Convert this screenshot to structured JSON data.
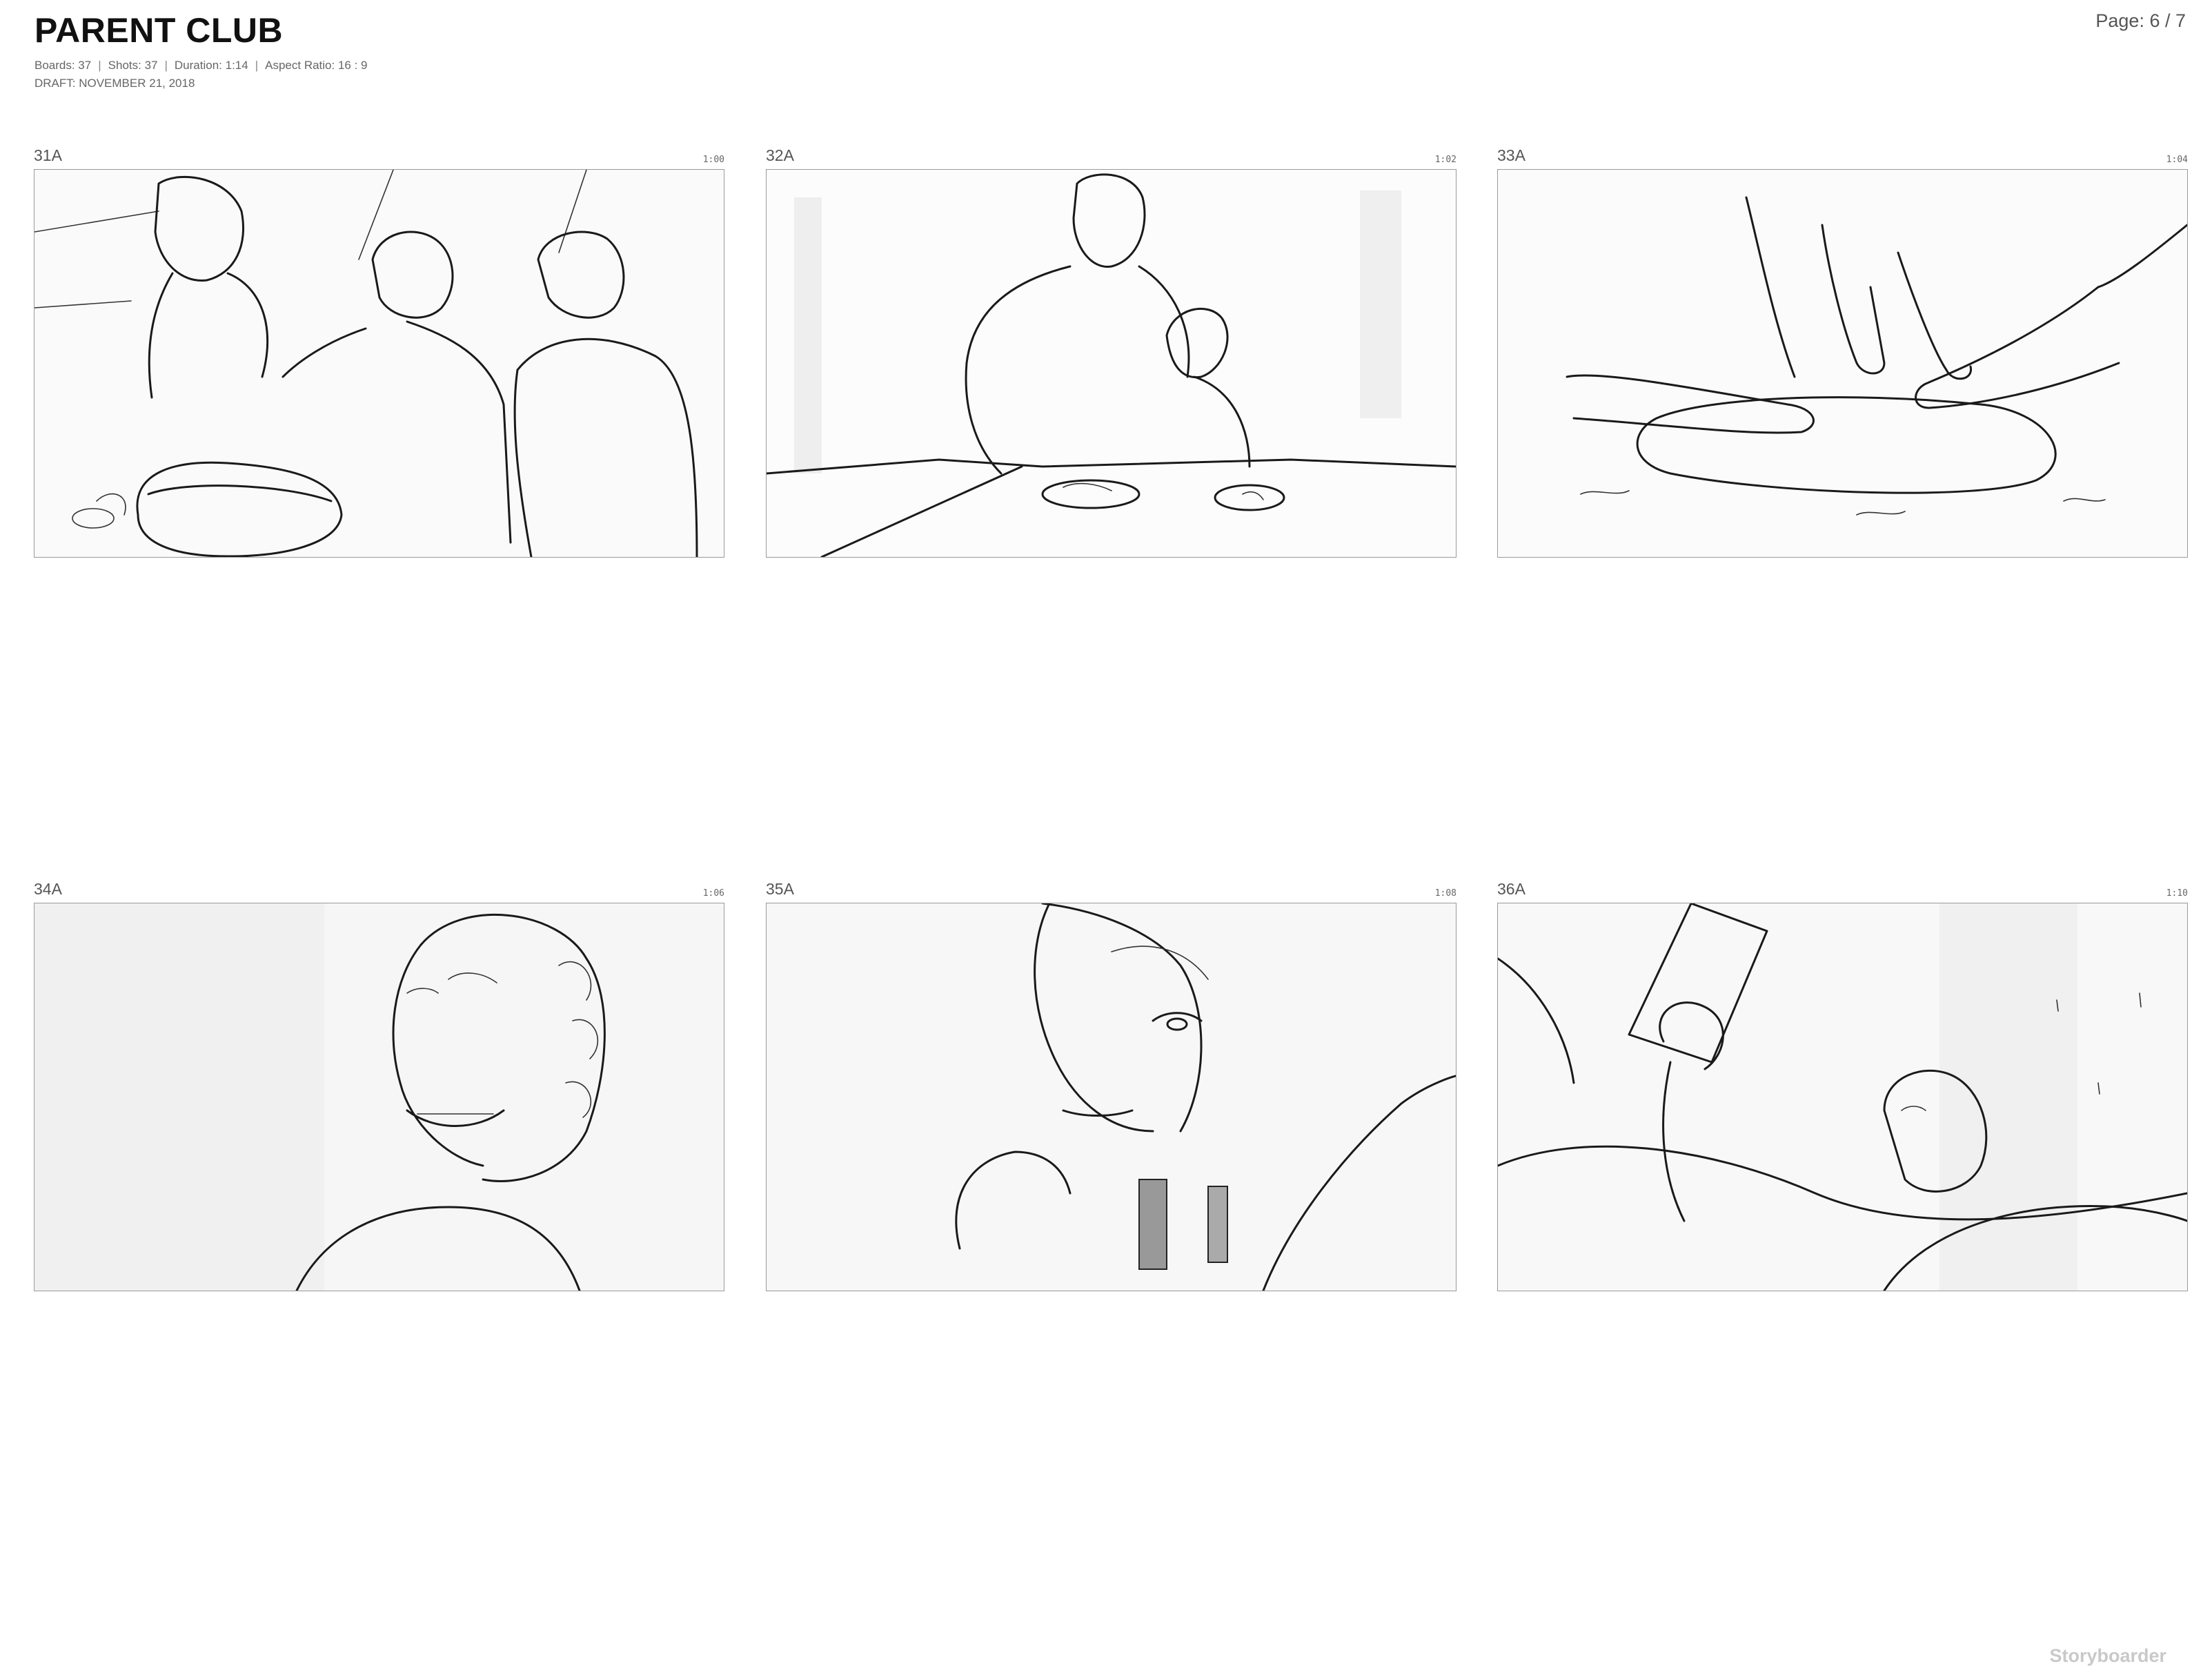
{
  "document": {
    "title": "PARENT CLUB",
    "meta": {
      "boards": "Boards: 37",
      "shots": "Shots: 37",
      "duration": "Duration: 1:14",
      "aspect_ratio": "Aspect Ratio: 16 : 9",
      "draft": "DRAFT: NOVEMBER 21, 2018"
    },
    "page": "Page: 6 / 7",
    "watermark": "Storyboarder"
  },
  "boards": [
    {
      "number": "31A",
      "time": "1:00",
      "description": "woman and two boys mixing in a bowl"
    },
    {
      "number": "32A",
      "time": "1:02",
      "description": "man and child preparing dough at a table"
    },
    {
      "number": "33A",
      "time": "1:04",
      "description": "hands kneading dough"
    },
    {
      "number": "34A",
      "time": "1:06",
      "description": "curly-haired woman smiling"
    },
    {
      "number": "35A",
      "time": "1:08",
      "description": "girl eating a snack"
    },
    {
      "number": "36A",
      "time": "1:10",
      "description": "child lying in bed holding a card"
    }
  ]
}
